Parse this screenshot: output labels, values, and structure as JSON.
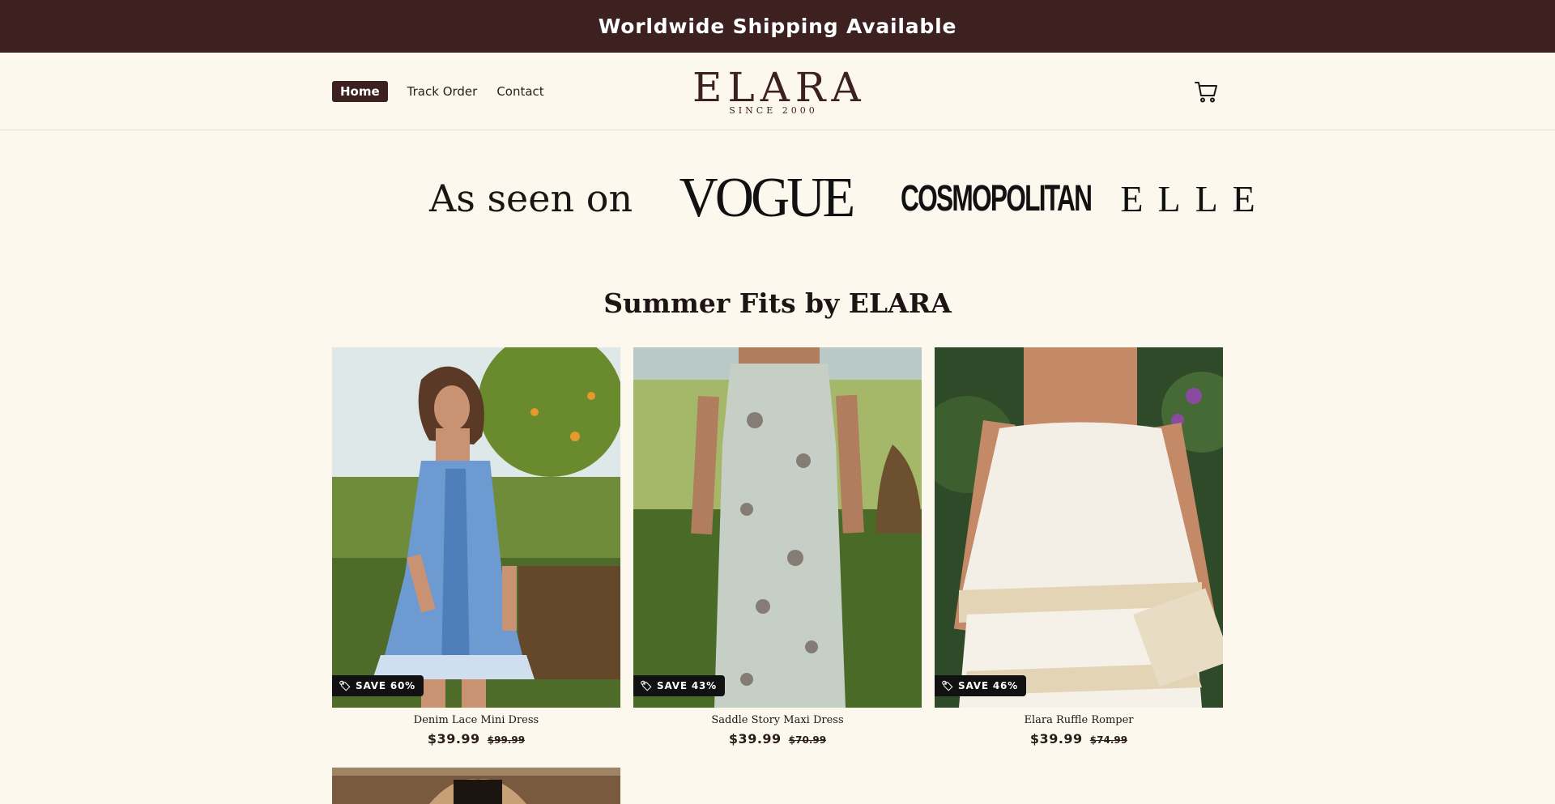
{
  "announcement": "Worldwide Shipping Available",
  "nav": {
    "items": [
      "Home",
      "Track Order",
      "Contact"
    ],
    "active": "Home"
  },
  "logo": {
    "name": "ELARA",
    "tagline": "SINCE 2000"
  },
  "cart": {
    "icon": "cart-icon"
  },
  "as_seen_on": {
    "label": "As seen on",
    "brands": [
      "VOGUE",
      "COSMOPOLITAN",
      "ELLE"
    ]
  },
  "section_title": "Summer Fits by ELARA",
  "products": [
    {
      "name": "Denim Lace Mini Dress",
      "price": "$39.99",
      "compare_price": "$99.99",
      "badge": "SAVE 60%"
    },
    {
      "name": "Saddle Story Maxi Dress",
      "price": "$39.99",
      "compare_price": "$70.99",
      "badge": "SAVE 43%"
    },
    {
      "name": "Elara Ruffle Romper",
      "price": "$39.99",
      "compare_price": "$74.99",
      "badge": "SAVE 46%"
    }
  ],
  "colors": {
    "brand": "#3d2020",
    "background": "#fdf8ee",
    "badge": "#111111"
  }
}
